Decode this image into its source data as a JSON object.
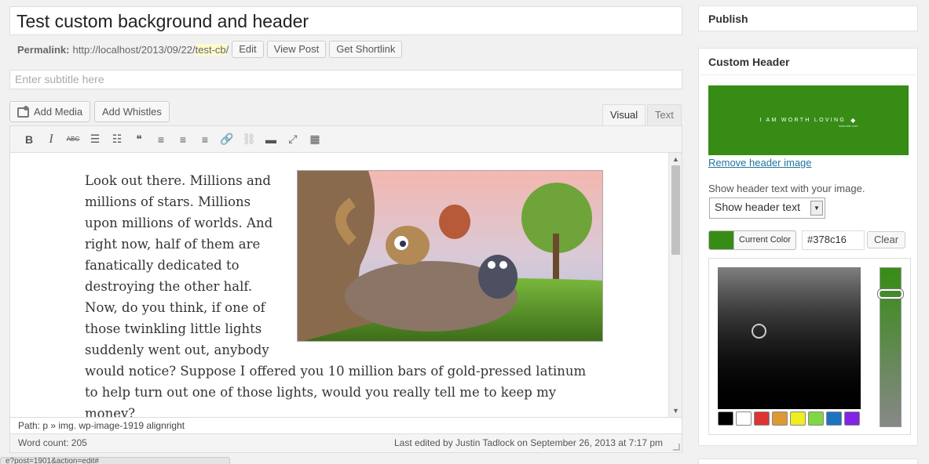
{
  "post": {
    "title": "Test custom background and header",
    "permalink_label": "Permalink:",
    "permalink_base": "http://localhost/2013/09/22/",
    "permalink_slug": "test-cb",
    "permalink_trailing": "/",
    "edit_button": "Edit",
    "view_post_button": "View Post",
    "shortlink_button": "Get Shortlink",
    "subtitle_placeholder": "Enter subtitle here"
  },
  "editor": {
    "add_media": "Add Media",
    "add_whistles": "Add Whistles",
    "tab_visual": "Visual",
    "tab_text": "Text",
    "toolbar": [
      {
        "name": "bold-icon",
        "glyph": "B"
      },
      {
        "name": "italic-icon",
        "glyph": "I"
      },
      {
        "name": "strikethrough-icon",
        "glyph": "ABC"
      },
      {
        "name": "bullet-list-icon",
        "glyph": "☰"
      },
      {
        "name": "numbered-list-icon",
        "glyph": "☷"
      },
      {
        "name": "blockquote-icon",
        "glyph": "❝"
      },
      {
        "name": "align-left-icon",
        "glyph": "≡"
      },
      {
        "name": "align-center-icon",
        "glyph": "≡"
      },
      {
        "name": "align-right-icon",
        "glyph": "≡"
      },
      {
        "name": "insert-link-icon",
        "glyph": "🔗"
      },
      {
        "name": "unlink-icon",
        "glyph": "⛓"
      },
      {
        "name": "read-more-icon",
        "glyph": "▬"
      },
      {
        "name": "fullscreen-icon",
        "glyph": "⤢"
      },
      {
        "name": "kitchen-sink-icon",
        "glyph": "▦"
      }
    ],
    "body_text": "Look out there. Millions and millions of stars. Millions upon millions of worlds. And right now, half of them are fanatically dedicated to destroying the other half. Now, do you think, if one of those twinkling little lights suddenly went out, anybody would notice? Suppose I offered you 10 million bars of gold-pressed latinum to help turn out one of those lights, would you really tell me to keep my money?",
    "path": "Path: p » img. wp-image-1919 alignright",
    "word_count": "Word count: 205",
    "last_edited": "Last edited by Justin Tadlock on September 26, 2013 at 7:17 pm",
    "bottom_tab_text": "e?post=1901&action=edit#"
  },
  "sidebar": {
    "publish_title": "Publish",
    "custom_header_title": "Custom Header",
    "header_image_text": "I AM WORTH LOVING",
    "header_image_sub": "www.site.com",
    "remove_header": "Remove header image",
    "show_header_label": "Show header text with your image.",
    "show_header_select": "Show header text",
    "current_color": "Current Color",
    "hex_value": "#378c16",
    "clear": "Clear",
    "accent": "#378c16",
    "palette": [
      "#000000",
      "#ffffff",
      "#dd3333",
      "#dd9933",
      "#eeee22",
      "#81d742",
      "#1e73be",
      "#8224e3"
    ]
  }
}
